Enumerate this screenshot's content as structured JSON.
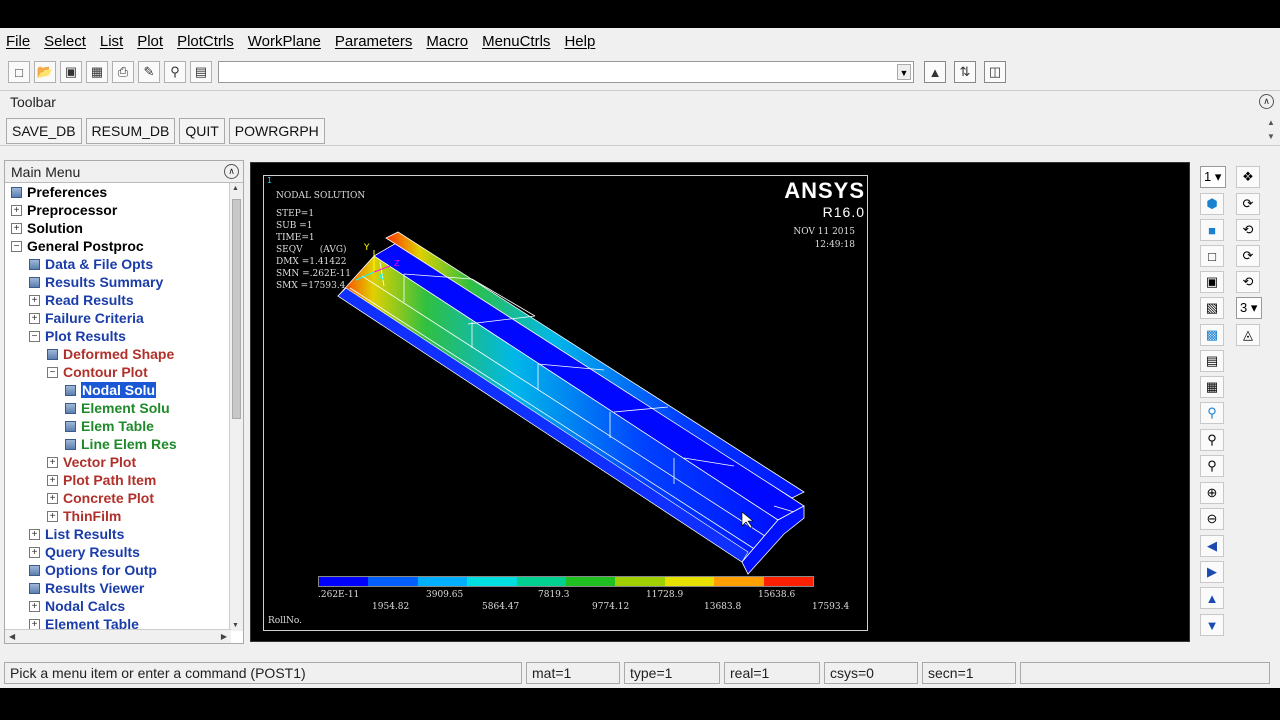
{
  "menubar": [
    "File",
    "Select",
    "List",
    "Plot",
    "PlotCtrls",
    "WorkPlane",
    "Parameters",
    "Macro",
    "MenuCtrls",
    "Help"
  ],
  "command": {
    "value": ""
  },
  "toolbar": {
    "label": "Toolbar",
    "buttons": [
      "SAVE_DB",
      "RESUM_DB",
      "QUIT",
      "POWRGRPH"
    ]
  },
  "main_menu": {
    "title": "Main Menu",
    "items": [
      {
        "label": "Preferences",
        "indent": 0,
        "kind": "icon",
        "color": "black"
      },
      {
        "label": "Preprocessor",
        "indent": 0,
        "kind": "expand",
        "color": "black"
      },
      {
        "label": "Solution",
        "indent": 0,
        "kind": "expand",
        "color": "black"
      },
      {
        "label": "General Postproc",
        "indent": 0,
        "kind": "collapse",
        "color": "black"
      },
      {
        "label": "Data & File Opts",
        "indent": 1,
        "kind": "icon",
        "color": "blue"
      },
      {
        "label": "Results Summary",
        "indent": 1,
        "kind": "icon",
        "color": "blue"
      },
      {
        "label": "Read Results",
        "indent": 1,
        "kind": "expand",
        "color": "blue"
      },
      {
        "label": "Failure Criteria",
        "indent": 1,
        "kind": "expand",
        "color": "blue"
      },
      {
        "label": "Plot Results",
        "indent": 1,
        "kind": "collapse",
        "color": "blue"
      },
      {
        "label": "Deformed Shape",
        "indent": 2,
        "kind": "icon",
        "color": "red"
      },
      {
        "label": "Contour Plot",
        "indent": 2,
        "kind": "collapse",
        "color": "red"
      },
      {
        "label": "Nodal Solu",
        "indent": 3,
        "kind": "icon",
        "color": "green",
        "selected": true
      },
      {
        "label": "Element Solu",
        "indent": 3,
        "kind": "icon",
        "color": "green"
      },
      {
        "label": "Elem Table",
        "indent": 3,
        "kind": "icon",
        "color": "green"
      },
      {
        "label": "Line Elem Res",
        "indent": 3,
        "kind": "icon",
        "color": "green"
      },
      {
        "label": "Vector Plot",
        "indent": 2,
        "kind": "expand",
        "color": "red"
      },
      {
        "label": "Plot Path Item",
        "indent": 2,
        "kind": "expand",
        "color": "red"
      },
      {
        "label": "Concrete Plot",
        "indent": 2,
        "kind": "expand",
        "color": "red"
      },
      {
        "label": "ThinFilm",
        "indent": 2,
        "kind": "expand",
        "color": "red"
      },
      {
        "label": "List Results",
        "indent": 1,
        "kind": "expand",
        "color": "blue"
      },
      {
        "label": "Query Results",
        "indent": 1,
        "kind": "expand",
        "color": "blue"
      },
      {
        "label": "Options for Outp",
        "indent": 1,
        "kind": "icon",
        "color": "blue"
      },
      {
        "label": "Results Viewer",
        "indent": 1,
        "kind": "icon",
        "color": "blue"
      },
      {
        "label": "Nodal Calcs",
        "indent": 1,
        "kind": "expand",
        "color": "blue"
      },
      {
        "label": "Element Table",
        "indent": 1,
        "kind": "expand",
        "color": "blue"
      }
    ]
  },
  "graphics": {
    "title": "NODAL SOLUTION",
    "window_no": "1",
    "info_lines": [
      "STEP=1",
      "SUB =1",
      "TIME=1",
      "SEQV      (AVG)",
      "DMX =1.41422",
      "SMN =.262E-11",
      "SMX =17593.4"
    ],
    "brand": "ANSYS",
    "version": "R16.0",
    "date": "NOV 11 2015",
    "time": "12:49:18",
    "axis_x": "X",
    "axis_y": "Y",
    "axis_z": "Z",
    "footer": "RollNo.",
    "legend_colors": [
      "#0000ff",
      "#0060ff",
      "#00b0ff",
      "#00e0e0",
      "#00d090",
      "#20c020",
      "#a0d000",
      "#e8e000",
      "#ffa000",
      "#ff2000"
    ],
    "legend_top": [
      ".262E-11",
      "3909.65",
      "7819.3",
      "11728.9",
      "15638.6"
    ],
    "legend_bottom": [
      "1954.82",
      "5864.47",
      "9774.12",
      "13683.8",
      "17593.4"
    ]
  },
  "right_toolbar": {
    "window_select": "1",
    "count_select": "3"
  },
  "status": {
    "prompt": "Pick a menu item or enter a command (POST1)",
    "mat": "mat=1",
    "type": "type=1",
    "real": "real=1",
    "csys": "csys=0",
    "secn": "secn=1"
  }
}
